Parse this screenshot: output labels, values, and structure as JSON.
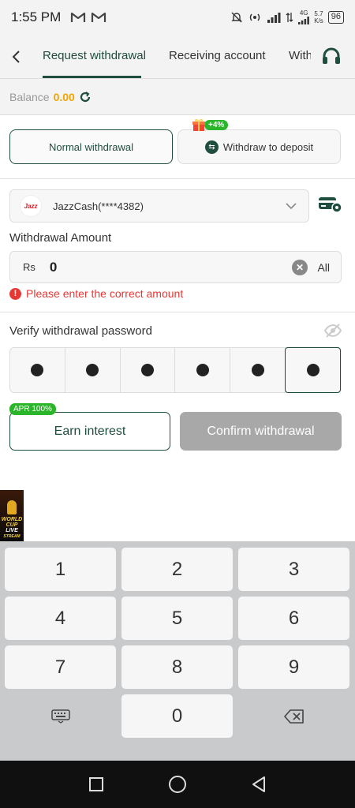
{
  "status_bar": {
    "time": "1:55 PM",
    "network_type": "4G",
    "speed_value": "5.7",
    "speed_unit": "K/s",
    "battery": "96"
  },
  "tabs": {
    "items": [
      {
        "label": "Request withdrawal",
        "active": true
      },
      {
        "label": "Receiving account",
        "active": false
      },
      {
        "label": "With",
        "active": false
      }
    ]
  },
  "balance": {
    "label": "Balance",
    "value": "0.00"
  },
  "withdrawal_types": {
    "normal_label": "Normal withdrawal",
    "deposit_label": "Withdraw to deposit",
    "bonus_badge": "+4%"
  },
  "account": {
    "logo_text": "Jazz",
    "label": "JazzCash(****4382)"
  },
  "amount": {
    "label": "Withdrawal Amount",
    "currency": "Rs",
    "value": "0",
    "all_label": "All",
    "error": "Please enter the correct amount"
  },
  "password": {
    "label": "Verify withdrawal password",
    "length": 6,
    "current_index": 5
  },
  "actions": {
    "apr_badge": "APR 100%",
    "earn_label": "Earn interest",
    "confirm_label": "Confirm withdrawal"
  },
  "promo": {
    "text_line1": "WORLD",
    "text_line2": "CUP",
    "text_line3": "LIVE",
    "text_line4": "STREAM"
  },
  "keypad": {
    "keys": [
      "1",
      "2",
      "3",
      "4",
      "5",
      "6",
      "7",
      "8",
      "9",
      "0"
    ]
  },
  "colors": {
    "accent": "#1f4d3f",
    "balance": "#f0a500",
    "error": "#e53935",
    "badge_green": "#2bb52b",
    "disabled_button": "#a8a8a8"
  }
}
